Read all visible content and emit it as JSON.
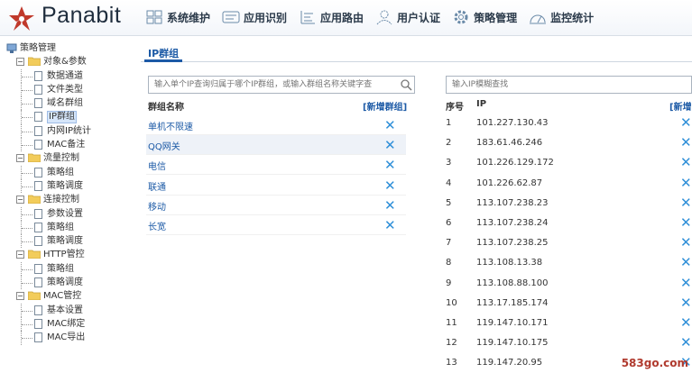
{
  "header": {
    "brand": "Panabit",
    "nav": [
      {
        "label": "系统维护",
        "icon": "system-maintenance-icon"
      },
      {
        "label": "应用识别",
        "icon": "app-recognition-icon"
      },
      {
        "label": "应用路由",
        "icon": "app-routing-icon"
      },
      {
        "label": "用户认证",
        "icon": "user-auth-icon"
      },
      {
        "label": "策略管理",
        "icon": "policy-gear-icon"
      },
      {
        "label": "监控统计",
        "icon": "monitor-stats-icon"
      }
    ]
  },
  "sidebar": {
    "root": "策略管理",
    "nodes": [
      {
        "label": "对象&参数",
        "type": "folder"
      },
      {
        "label": "数据通道",
        "type": "leaf"
      },
      {
        "label": "文件类型",
        "type": "leaf"
      },
      {
        "label": "域名群组",
        "type": "leaf"
      },
      {
        "label": "IP群组",
        "type": "leaf",
        "selected": true
      },
      {
        "label": "内网IP统计",
        "type": "leaf"
      },
      {
        "label": "MAC备注",
        "type": "leaf"
      },
      {
        "label": "流量控制",
        "type": "folder"
      },
      {
        "label": "策略组",
        "type": "leaf"
      },
      {
        "label": "策略调度",
        "type": "leaf"
      },
      {
        "label": "连接控制",
        "type": "folder"
      },
      {
        "label": "参数设置",
        "type": "leaf"
      },
      {
        "label": "策略组",
        "type": "leaf"
      },
      {
        "label": "策略调度",
        "type": "leaf"
      },
      {
        "label": "HTTP管控",
        "type": "folder"
      },
      {
        "label": "策略组",
        "type": "leaf"
      },
      {
        "label": "策略调度",
        "type": "leaf"
      },
      {
        "label": "MAC管控",
        "type": "folder"
      },
      {
        "label": "基本设置",
        "type": "leaf"
      },
      {
        "label": "MAC绑定",
        "type": "leaf"
      },
      {
        "label": "MAC导出",
        "type": "leaf"
      }
    ]
  },
  "main": {
    "tab_title": "IP群组",
    "left": {
      "search_placeholder": "输入单个IP查询归属于哪个IP群组，或输入群组名称关键字查",
      "col_name": "群组名称",
      "add_link": "[新增群组]",
      "groups": [
        "单机不限速",
        "QQ网关",
        "电信",
        "联通",
        "移动",
        "长宽"
      ]
    },
    "right": {
      "search_placeholder": "输入IP模糊查找",
      "col_index": "序号",
      "col_ip": "IP",
      "add_link": "[新增",
      "rows": [
        {
          "idx": "1",
          "ip": "101.227.130.43"
        },
        {
          "idx": "2",
          "ip": "183.61.46.246"
        },
        {
          "idx": "3",
          "ip": "101.226.129.172"
        },
        {
          "idx": "4",
          "ip": "101.226.62.87"
        },
        {
          "idx": "5",
          "ip": "113.107.238.23"
        },
        {
          "idx": "6",
          "ip": "113.107.238.24"
        },
        {
          "idx": "7",
          "ip": "113.107.238.25"
        },
        {
          "idx": "8",
          "ip": "113.108.13.38"
        },
        {
          "idx": "9",
          "ip": "113.108.88.100"
        },
        {
          "idx": "10",
          "ip": "113.17.185.174"
        },
        {
          "idx": "11",
          "ip": "119.147.10.171"
        },
        {
          "idx": "12",
          "ip": "119.147.10.175"
        },
        {
          "idx": "13",
          "ip": "119.147.20.95"
        }
      ]
    }
  },
  "watermark": "583go.com",
  "colors": {
    "accent": "#1c5aa6",
    "delete": "#2f8fd8",
    "logo": "#c0392b"
  }
}
